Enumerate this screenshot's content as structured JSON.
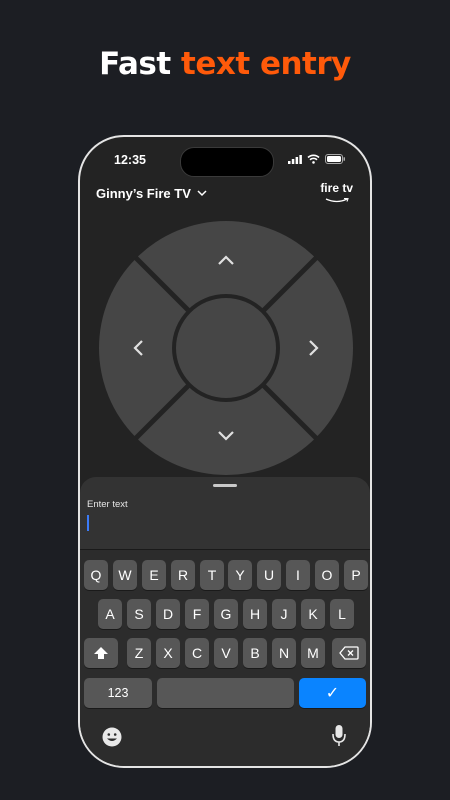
{
  "headline": {
    "part1": "Fast",
    "part2": "text entry"
  },
  "status_bar": {
    "time": "12:35"
  },
  "device_selector": {
    "name": "Ginny’s Fire TV"
  },
  "brand": {
    "logo_text": "fire tv"
  },
  "text_entry": {
    "label": "Enter text",
    "value": ""
  },
  "keyboard": {
    "row1": [
      "Q",
      "W",
      "E",
      "R",
      "T",
      "Y",
      "U",
      "I",
      "O",
      "P"
    ],
    "row2": [
      "A",
      "S",
      "D",
      "F",
      "G",
      "H",
      "J",
      "K",
      "L"
    ],
    "row3": [
      "Z",
      "X",
      "C",
      "V",
      "B",
      "N",
      "M"
    ],
    "numbers_key": "123",
    "confirm_key": "✓"
  },
  "colors": {
    "accent": "#ff5a0a",
    "confirm": "#0a84ff",
    "caret": "#3b7bf7"
  }
}
